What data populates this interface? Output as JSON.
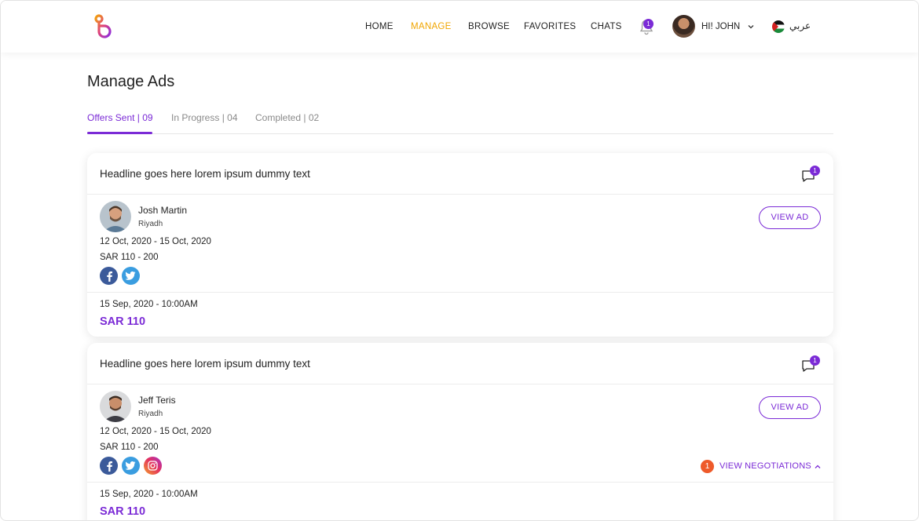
{
  "header": {
    "nav": [
      {
        "label": "HOME",
        "active": false
      },
      {
        "label": "MANAGE",
        "active": true
      },
      {
        "label": "BROWSE",
        "active": false
      },
      {
        "label": "FAVORITES",
        "active": false
      },
      {
        "label": "CHATS",
        "active": false
      }
    ],
    "notification_count": "1",
    "user_greeting": "HI! JOHN",
    "language": "عربي"
  },
  "page": {
    "title": "Manage Ads",
    "tabs": [
      {
        "label": "Offers Sent | 09",
        "active": true
      },
      {
        "label": "In Progress | 04",
        "active": false
      },
      {
        "label": "Completed | 02",
        "active": false
      }
    ]
  },
  "cards": [
    {
      "headline": "Headline goes here lorem ipsum dummy text",
      "chat_count": "1",
      "name": "Josh Martin",
      "city": "Riyadh",
      "dates": "12 Oct, 2020 - 15 Oct, 2020",
      "price_range": "SAR 110 - 200",
      "view_ad_label": "VIEW AD",
      "offer_time": "15 Sep, 2020 - 10:00AM",
      "offer_price": "SAR 110"
    },
    {
      "headline": "Headline goes here lorem ipsum dummy text",
      "chat_count": "1",
      "name": "Jeff Teris",
      "city": "Riyadh",
      "dates": "12 Oct, 2020 - 15 Oct, 2020",
      "price_range": "SAR 110 - 200",
      "view_ad_label": "VIEW AD",
      "negotiation_count": "1",
      "negotiations_label": "VIEW NEGOTIATIONS",
      "offer_time": "15 Sep, 2020 - 10:00AM",
      "offer_price": "SAR 110"
    }
  ],
  "colors": {
    "accent": "#7b2bd6",
    "active_nav": "#f0a500",
    "negotiation_badge": "#ee5a2a"
  }
}
